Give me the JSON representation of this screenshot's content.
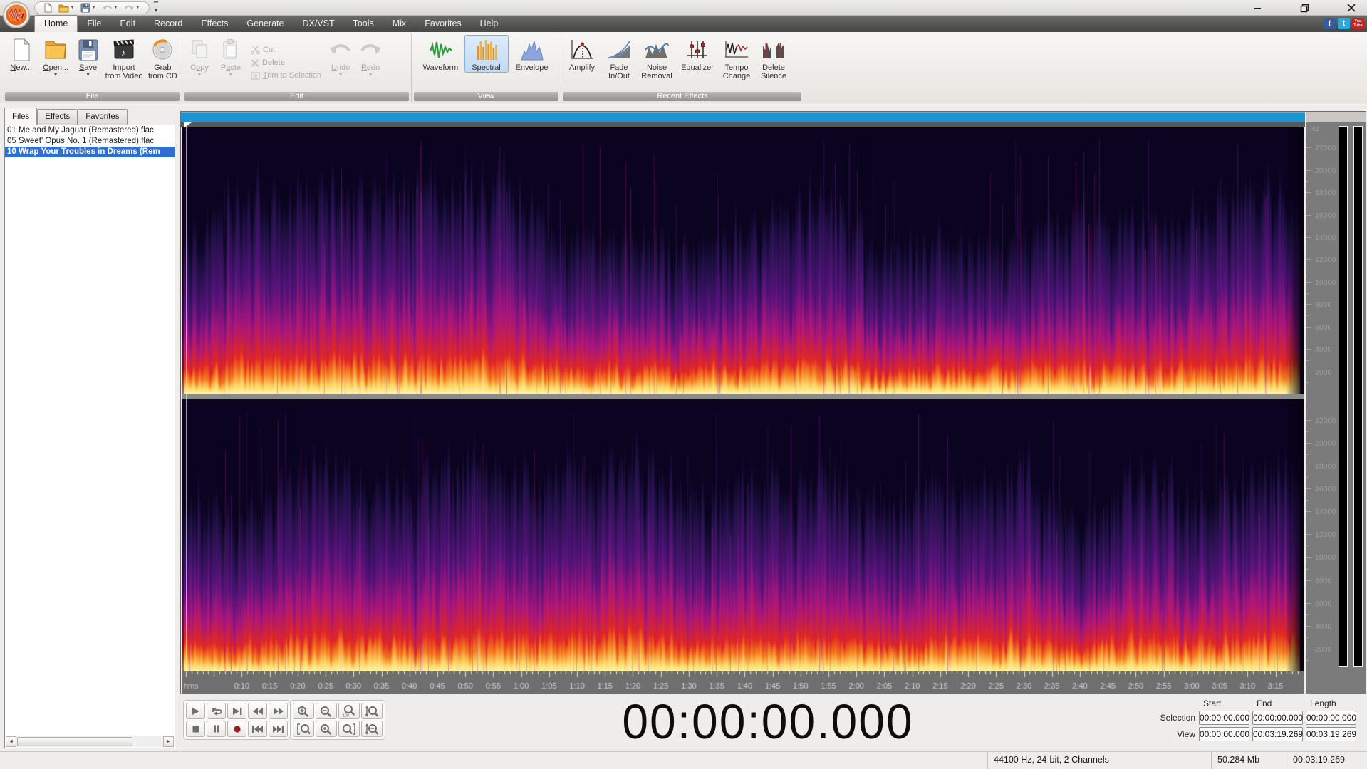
{
  "app": {
    "name": "WavePad-style audio editor",
    "window_controls": [
      "minimize",
      "maximize",
      "close"
    ],
    "quick_access_icons": [
      "new-document",
      "open-folder",
      "save",
      "undo",
      "redo",
      "customize-toolbar"
    ]
  },
  "menu": {
    "tabs": [
      "Home",
      "File",
      "Edit",
      "Record",
      "Effects",
      "Generate",
      "DX/VST",
      "Tools",
      "Mix",
      "Favorites",
      "Help"
    ],
    "active_tab": "Home",
    "social": {
      "facebook_letter": "f",
      "twitter_letter": "t",
      "youtube_lines": [
        "You",
        "Tube"
      ],
      "facebook_color": "#3a5a99",
      "twitter_color": "#2aa9e0",
      "youtube_color": "#cc1f1f"
    }
  },
  "ribbon": {
    "group_labels": [
      "File",
      "Edit",
      "View",
      "Recent Effects"
    ],
    "file": {
      "new": {
        "m": "N",
        "post": "ew..."
      },
      "open": {
        "m": "O",
        "post": "pen..."
      },
      "save": {
        "m": "S",
        "post": "ave"
      },
      "import": {
        "l1": "Import",
        "l2": "from Video"
      },
      "grab": {
        "l1": "Grab",
        "l2": "from CD"
      }
    },
    "edit": {
      "copy": {
        "pre": "C",
        "m": "o",
        "post": "py"
      },
      "paste": {
        "pre": "P",
        "m": "a",
        "post": "ste"
      },
      "cut": {
        "m": "C",
        "post": "ut"
      },
      "delete": {
        "m": "D",
        "post": "elete"
      },
      "trim": {
        "m": "T",
        "post": "rim to Selection"
      },
      "undo": {
        "m": "U",
        "post": "ndo"
      },
      "redo": {
        "m": "R",
        "post": "edo"
      }
    },
    "view": {
      "waveform": "Waveform",
      "spectral": "Spectral",
      "envelope": "Envelope",
      "active": "Spectral"
    },
    "effects": {
      "amplify": "Amplify",
      "fade": {
        "l1": "Fade",
        "l2": "In/Out"
      },
      "noise": {
        "l1": "Noise",
        "l2": "Removal"
      },
      "equalizer": "Equalizer",
      "tempo": {
        "l1": "Tempo",
        "l2": "Change"
      },
      "silence": {
        "l1": "Delete",
        "l2": "Silence"
      }
    }
  },
  "sidebar": {
    "tabs": [
      "Files",
      "Effects",
      "Favorites"
    ],
    "active_tab": "Files",
    "files": [
      "01 Me and My Jaguar (Remastered).flac",
      "05 Sweet' Opus No. 1 (Remastered).flac",
      "10 Wrap Your Troubles in Dreams (Rem"
    ],
    "selected_index": 2
  },
  "editor": {
    "channels": 2,
    "frequency_axis": {
      "unit": "Hz",
      "major_labels": [
        22000,
        20000,
        18000,
        16000,
        14000,
        12000,
        10000,
        8000,
        6000,
        4000,
        2000
      ],
      "minor_step": 1000,
      "max_hz": 23000
    },
    "timeline": {
      "unit_label": "hms",
      "label_start_s": 10,
      "label_step_s": 5,
      "duration_s": 199.269,
      "labels": [
        "0:10",
        "0:15",
        "0:20",
        "0:25",
        "0:30",
        "0:35",
        "0:40",
        "0:45",
        "0:50",
        "0:55",
        "1:00",
        "1:05",
        "1:10",
        "1:15",
        "1:20",
        "1:25",
        "1:30",
        "1:35",
        "1:40",
        "1:45",
        "1:50",
        "1:55",
        "2:00",
        "2:05",
        "2:10",
        "2:15",
        "2:20",
        "2:25",
        "2:30",
        "2:35",
        "2:40",
        "2:45",
        "2:50",
        "2:55",
        "3:00",
        "3:05",
        "3:10",
        "3:15"
      ]
    },
    "spectrogram_palette": {
      "deep": "#0a0420",
      "navy": "#221048",
      "purple": "#531379",
      "magenta": "#a6157c",
      "red": "#e02723",
      "orange": "#f4781e",
      "yellow": "#fbd96a",
      "pale": "#fdf3ae"
    },
    "scrollbar_color": "#1d93cf"
  },
  "transport": {
    "buttons_row1": [
      "play",
      "loop-play",
      "play-to-end",
      "rewind",
      "fast-forward"
    ],
    "buttons_row2": [
      "stop",
      "pause",
      "record",
      "go-to-start",
      "go-to-end"
    ],
    "record_color": "#a5191f"
  },
  "zoom_controls": {
    "buttons_row1": [
      "zoom-in",
      "zoom-out",
      "zoom-100",
      "zoom-vertical"
    ],
    "buttons_row2": [
      "zoom-selection-start",
      "zoom-full",
      "zoom-selection-end",
      "zoom-vertical-out"
    ],
    "zoom_100_label": "100"
  },
  "time_display": {
    "value": "00:00:00.000"
  },
  "selection_table": {
    "headers": [
      "Start",
      "End",
      "Length"
    ],
    "rows": [
      {
        "label": "Selection",
        "values": [
          "00:00:00.000",
          "00:00:00.000",
          "00:00:00.000"
        ]
      },
      {
        "label": "View",
        "values": [
          "00:00:00.000",
          "00:03:19.269",
          "00:03:19.269"
        ]
      }
    ]
  },
  "status_bar": {
    "audio_format": "44100 Hz, 24-bit, 2 Channels",
    "file_size": "50.284 Mb",
    "file_length": "00:03:19.269"
  }
}
